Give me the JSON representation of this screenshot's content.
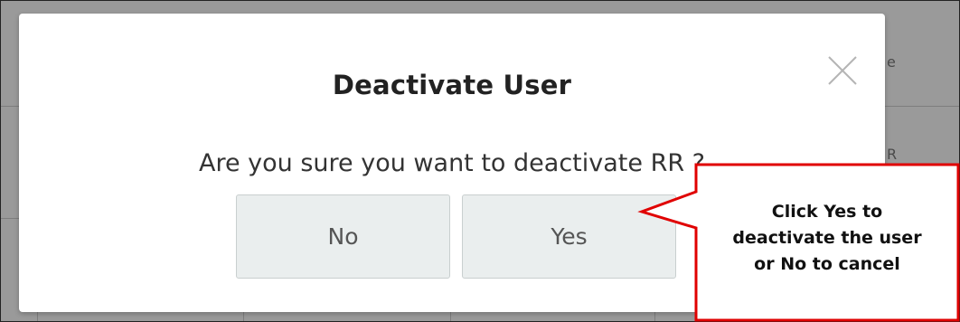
{
  "dialog": {
    "title": "Deactivate User",
    "message": "Are you sure you want to deactivate RR ?",
    "close_icon": "close-icon",
    "buttons": {
      "no_label": "No",
      "yes_label": "Yes"
    }
  },
  "background": {
    "partial_texts": [
      "e",
      "R"
    ]
  },
  "callout": {
    "line1": "Click Yes to",
    "line2": "deactivate the user",
    "line3": "or No to cancel",
    "border_color": "#e00000"
  },
  "colors": {
    "overlay": "#9a9a9a",
    "button_bg": "#eaeeee",
    "button_text": "#555555",
    "callout_border": "#e00000"
  }
}
